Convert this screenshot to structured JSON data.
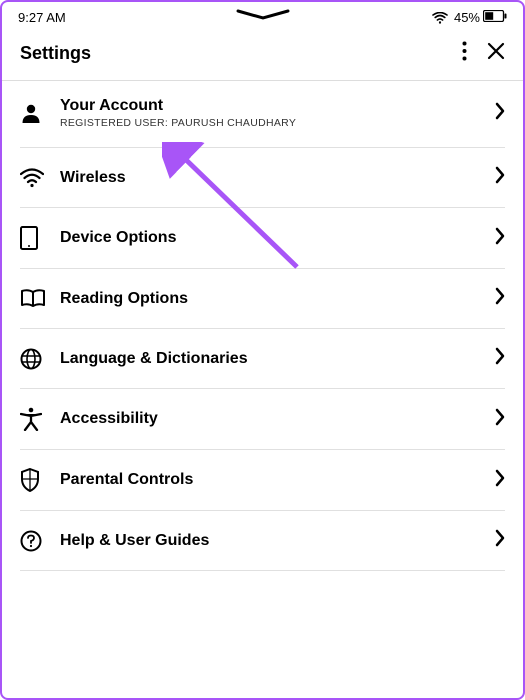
{
  "status": {
    "time": "9:27 AM",
    "battery_pct": "45%"
  },
  "header": {
    "title": "Settings"
  },
  "rows": {
    "account": {
      "title": "Your Account",
      "sub": "REGISTERED USER: PAURUSH CHAUDHARY"
    },
    "wireless": {
      "title": "Wireless"
    },
    "device": {
      "title": "Device Options"
    },
    "reading": {
      "title": "Reading Options"
    },
    "lang": {
      "title": "Language & Dictionaries"
    },
    "access": {
      "title": "Accessibility"
    },
    "parental": {
      "title": "Parental Controls"
    },
    "help": {
      "title": "Help & User Guides"
    }
  },
  "annotation": {
    "arrow_color": "#a855f7"
  }
}
